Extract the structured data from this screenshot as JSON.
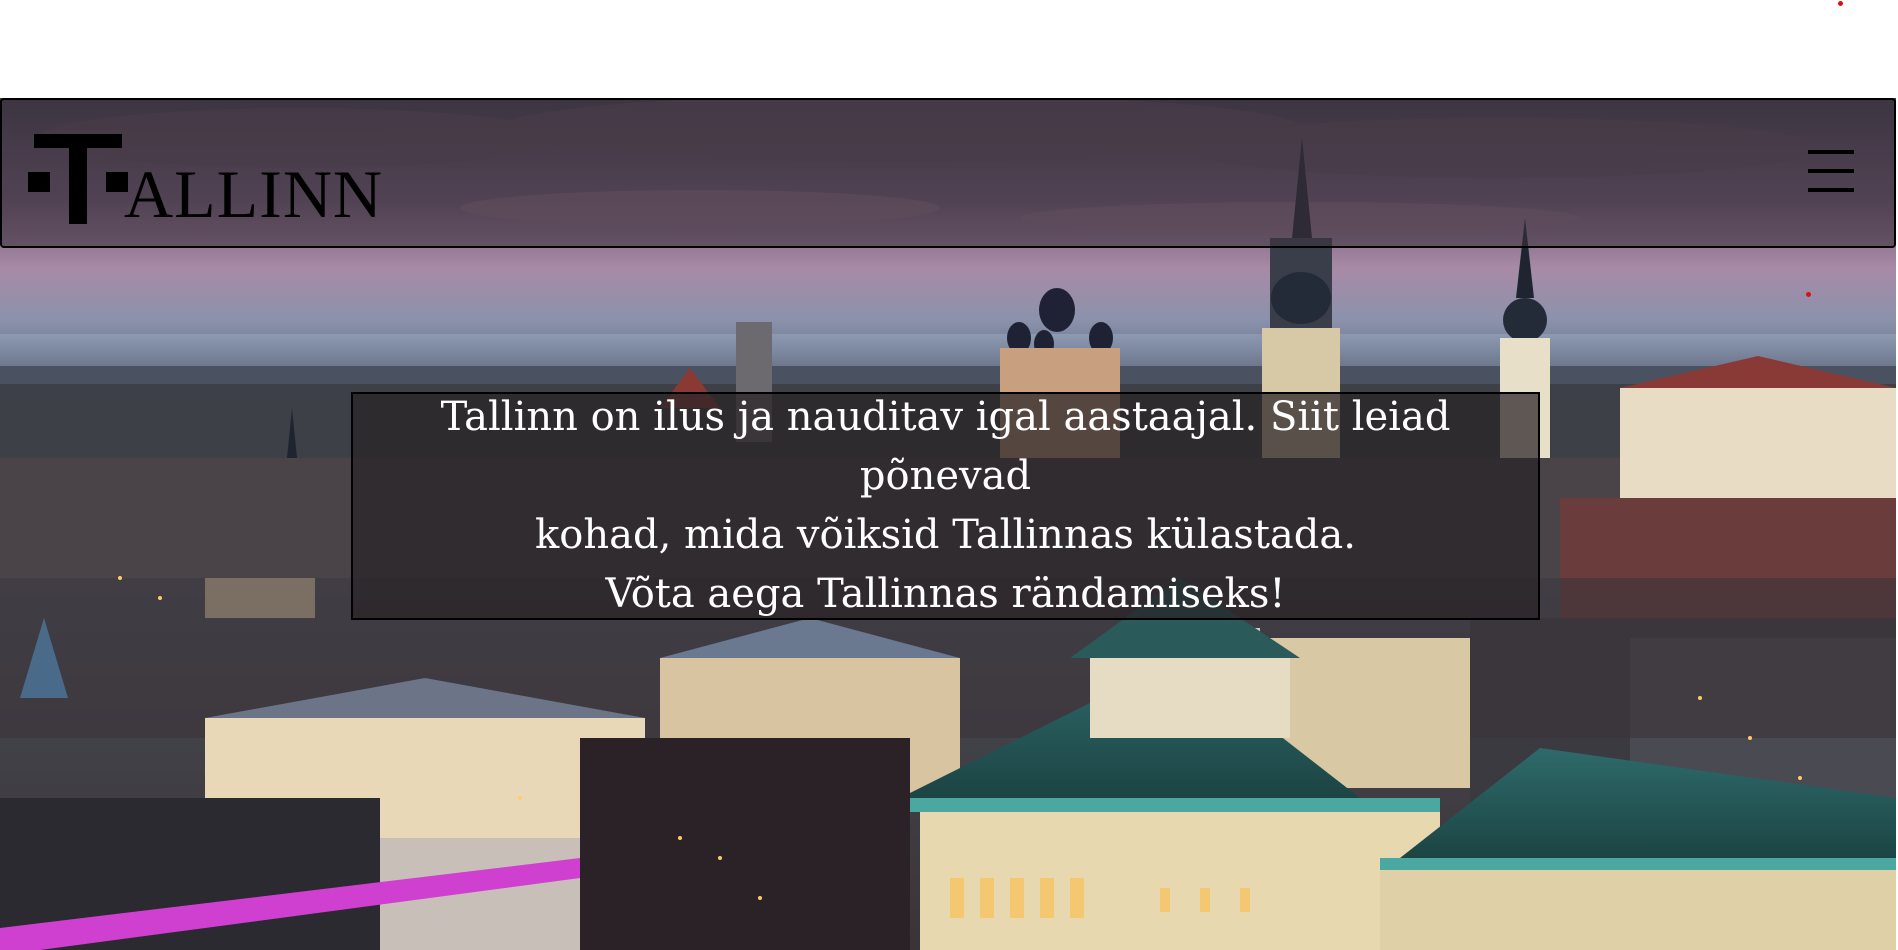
{
  "header": {
    "logo_letter": "T",
    "logo_text": "ALLINN",
    "menu_icon": "hamburger-menu-icon"
  },
  "hero": {
    "image_subject": "Tallinn city skyline at dusk",
    "line1": "Tallinn on ilus ja nauditav igal aastaajal. Siit leiad põnevad",
    "line2": "kohad, mida võiksid Tallinnas külastada.",
    "line3": "Võta aega Tallinnas rändamiseks!"
  },
  "colors": {
    "text": "#ffffff",
    "logo": "#000000",
    "dot": "#d41414"
  }
}
